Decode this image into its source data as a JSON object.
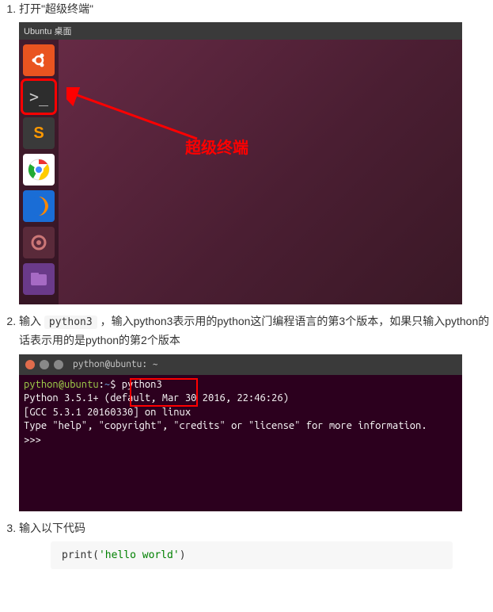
{
  "steps": [
    {
      "num": "1.",
      "text": "打开\"超级终端\""
    },
    {
      "num": "2.",
      "pre": "输入 ",
      "code": "python3",
      "post": " ，输入python3表示用的python这门编程语言的第3个版本，如果只输入python的话表示用的是python的第2个版本"
    },
    {
      "num": "3.",
      "text": "输入以下代码"
    }
  ],
  "ss1": {
    "menubar": "Ubuntu 桌面",
    "annotation": "超级终端"
  },
  "ss2": {
    "title": "python@ubuntu: ~",
    "prompt_user": "python@ubuntu",
    "prompt_sep": ":",
    "prompt_path": "~",
    "prompt_end": "$ ",
    "cmd": "python3",
    "line2": "Python 3.5.1+ (default, Mar 30 2016, 22:46:26)",
    "line3": "[GCC 5.3.1 20160330] on linux",
    "line4": "Type \"help\", \"copyright\", \"credits\" or \"license\" for more information.",
    "line5": ">>>"
  },
  "codeblock": {
    "fn": "print",
    "open": "(",
    "str": "'hello world'",
    "close": ")"
  }
}
